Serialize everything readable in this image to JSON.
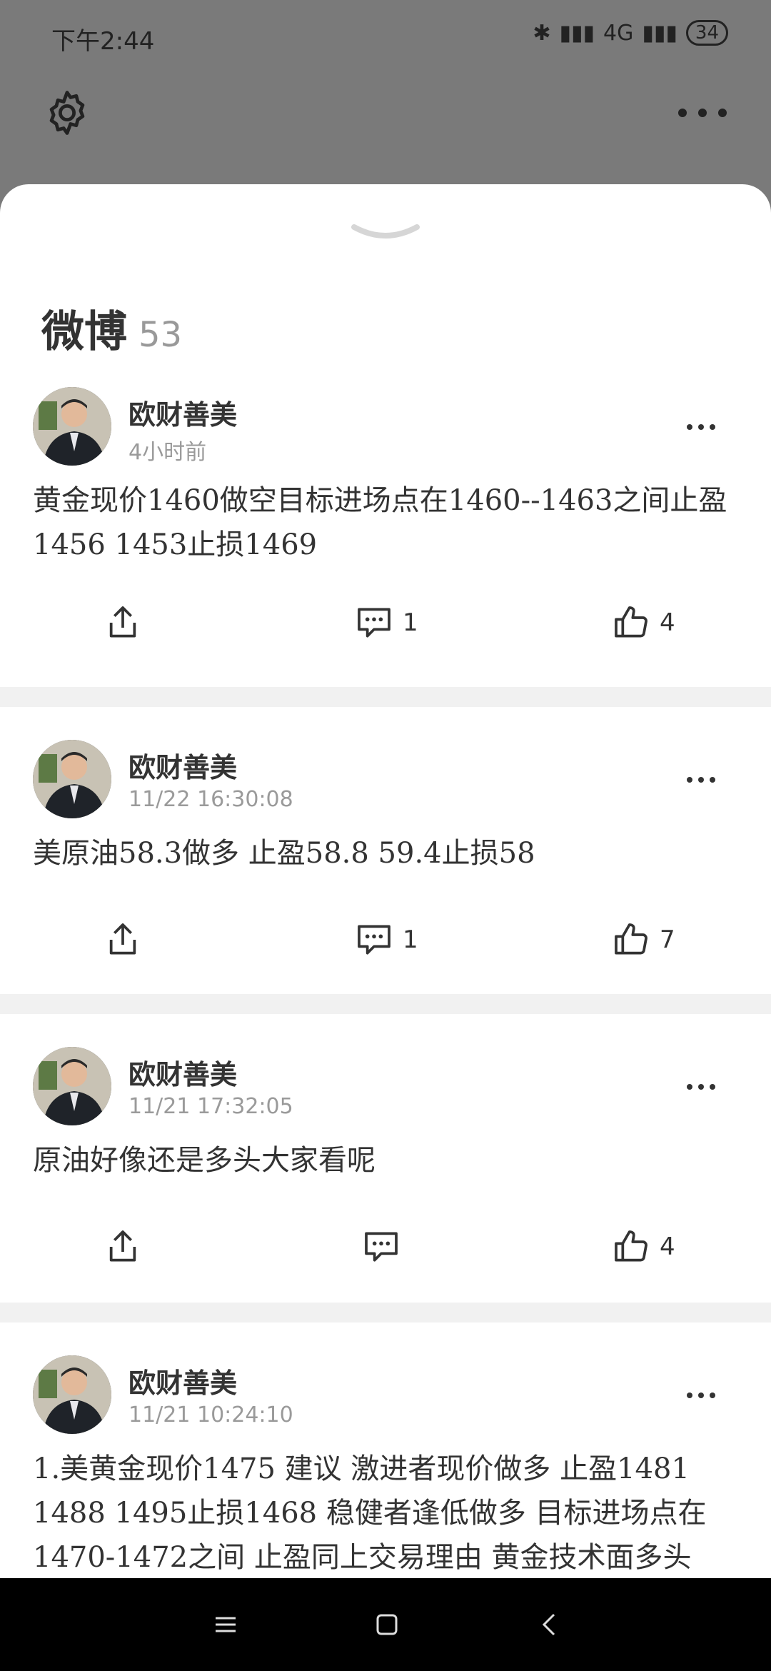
{
  "status": {
    "time": "下午2:44",
    "network": "4G",
    "battery": "34"
  },
  "sheet": {
    "title": "微博",
    "count": "53"
  },
  "posts": [
    {
      "author": "欧财善美",
      "time": "4小时前",
      "content": "黄金现价1460做空目标进场点在1460--1463之间止盈1456 1453止损1469",
      "comments": "1",
      "likes": "4"
    },
    {
      "author": "欧财善美",
      "time": "11/22 16:30:08",
      "content": "美原油58.3做多 止盈58.8 59.4止损58",
      "comments": "1",
      "likes": "7"
    },
    {
      "author": "欧财善美",
      "time": "11/21 17:32:05",
      "content": "原油好像还是多头大家看呢",
      "comments": "",
      "likes": "4"
    },
    {
      "author": "欧财善美",
      "time": "11/21 10:24:10",
      "content": "1.美黄金现价1475 建议 激进者现价做多 止盈1481 1488 1495止损1468 稳健者逢低做多 目标进场点在1470-1472之间 止盈同上交易理由 黄金技术面多头",
      "comments": "",
      "likes": ""
    }
  ]
}
